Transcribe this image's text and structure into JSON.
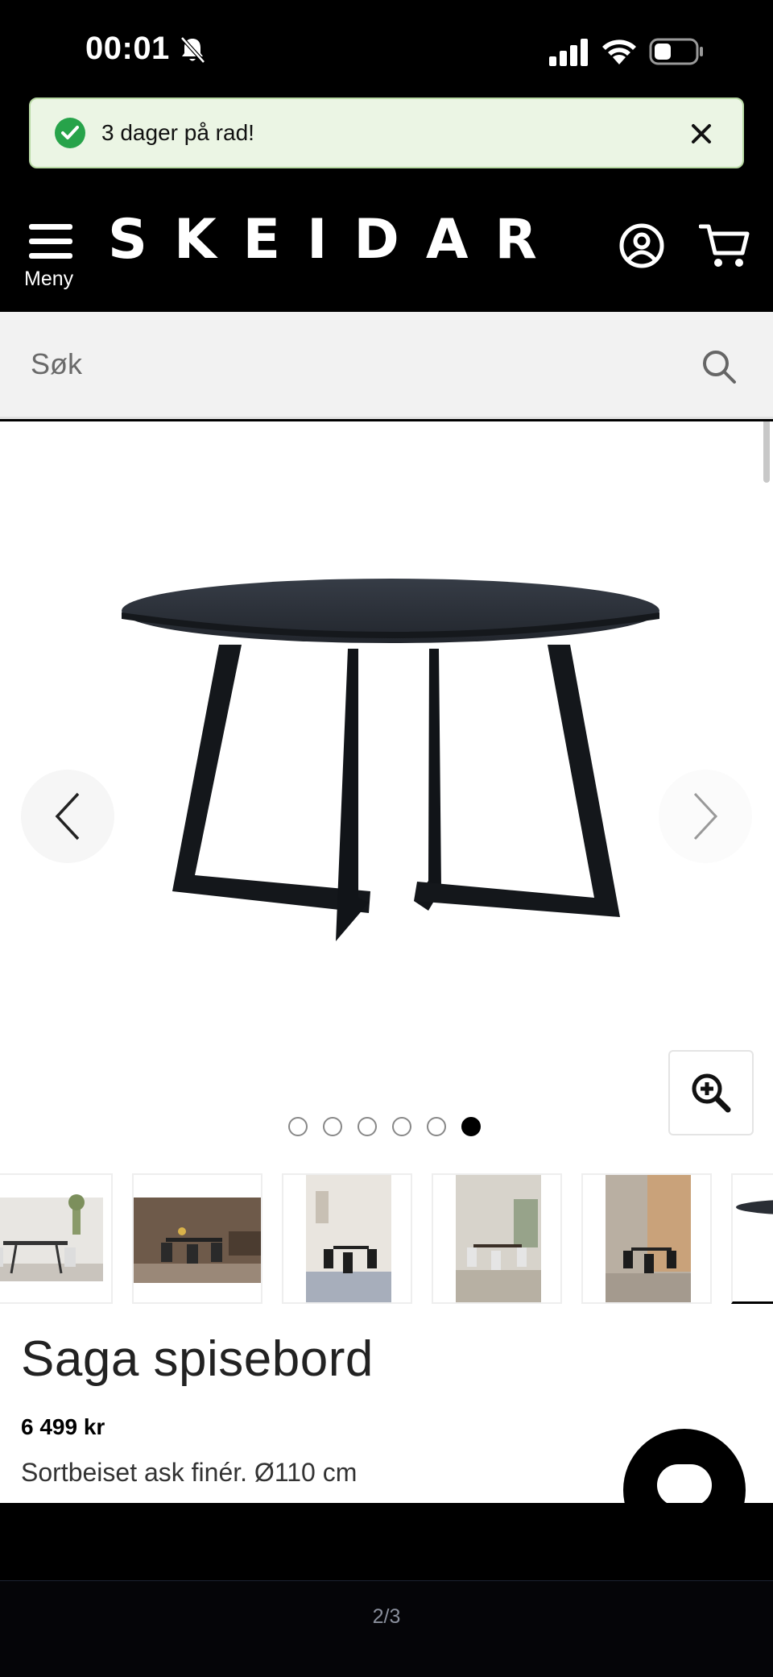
{
  "status_bar": {
    "time": "00:01"
  },
  "toast": {
    "message": "3 dager på rad!"
  },
  "header": {
    "menu_label": "Meny",
    "logo": "SKEIDAR"
  },
  "search": {
    "placeholder": "Søk"
  },
  "gallery": {
    "total_images": 6,
    "active_index": 5
  },
  "product": {
    "title": "Saga spisebord",
    "price": "6 499 kr",
    "description": "Sortbeiset ask finér. Ø110 cm"
  },
  "bottom": {
    "page_indicator": "2/3"
  },
  "colors": {
    "toast_bg": "#ebf5e4",
    "toast_check": "#27a34a",
    "brand_bg": "#000000"
  }
}
